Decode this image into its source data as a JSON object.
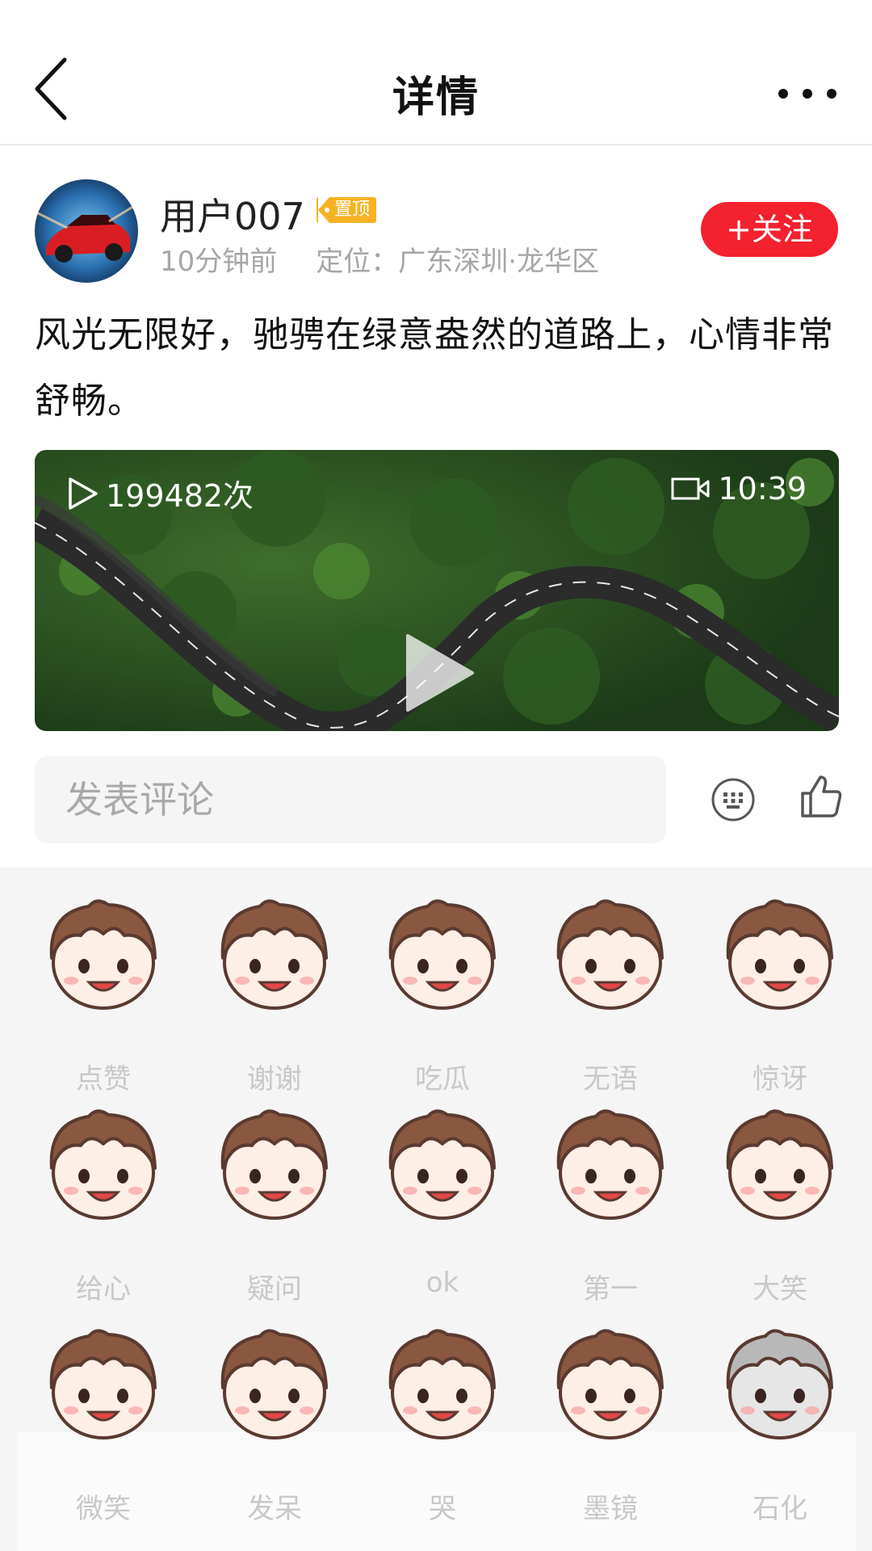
{
  "header": {
    "title": "详情",
    "back_icon": "chevron-left-icon",
    "more_icon": "more-dots-icon"
  },
  "post": {
    "username": "用户007",
    "pin_badge": "置顶",
    "time": "10分钟前",
    "location": "定位：广东深圳·龙华区",
    "follow_label": "+关注",
    "text": "风光无限好，驰骋在绿意盎然的道路上，心情非常舒畅。",
    "video": {
      "views": "199482次",
      "duration": "10:39"
    }
  },
  "comment": {
    "placeholder": "发表评论"
  },
  "emojis": [
    {
      "label": "点赞"
    },
    {
      "label": "谢谢"
    },
    {
      "label": "吃瓜"
    },
    {
      "label": "无语"
    },
    {
      "label": "惊讶"
    },
    {
      "label": "给心"
    },
    {
      "label": "疑问"
    },
    {
      "label": "ok"
    },
    {
      "label": "第一"
    },
    {
      "label": "大笑"
    },
    {
      "label": "微笑"
    },
    {
      "label": "发呆"
    },
    {
      "label": "哭"
    },
    {
      "label": "墨镜"
    },
    {
      "label": "石化"
    }
  ],
  "colors": {
    "accent": "#f4212e",
    "pin": "#f5b324",
    "hair": "#8a5740",
    "skin": "#fdeee6"
  }
}
